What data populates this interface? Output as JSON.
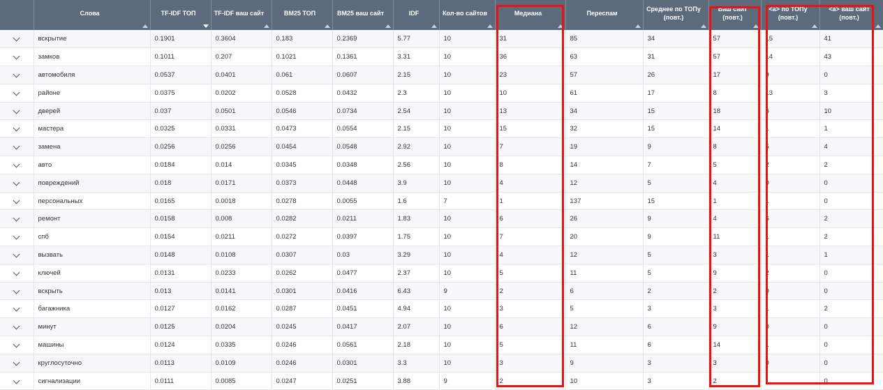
{
  "columns": [
    {
      "label": "",
      "sortable": false
    },
    {
      "label": "Слова",
      "sortable": true
    },
    {
      "label": "TF-IDF ТОП",
      "sortable": true,
      "sorted_desc": true
    },
    {
      "label": "TF-IDF ваш сайт",
      "sortable": true
    },
    {
      "label": "BM25 ТОП",
      "sortable": true
    },
    {
      "label": "BM25 ваш сайт",
      "sortable": true
    },
    {
      "label": "IDF",
      "sortable": true
    },
    {
      "label": "Кол-во сайтов",
      "sortable": true
    },
    {
      "label": "Медиана",
      "sortable": true
    },
    {
      "label": "Переспам",
      "sortable": true
    },
    {
      "label": "Среднее по ТОПу (повт.)",
      "sortable": true
    },
    {
      "label": "Ваш сайт (повт.)",
      "sortable": true
    },
    {
      "label": "<a> по ТОПу (повт.)",
      "sortable": true
    },
    {
      "label": "<a> ваш сайт (повт.)",
      "sortable": true
    }
  ],
  "rows": [
    [
      "вскрытие",
      "0.1901",
      "0.3604",
      "0.183",
      "0.2369",
      "5.77",
      "10",
      "31",
      "85",
      "34",
      "57",
      "15",
      "41"
    ],
    [
      "замков",
      "0.1011",
      "0.207",
      "0.1021",
      "0.1361",
      "3.31",
      "10",
      "36",
      "63",
      "31",
      "57",
      "14",
      "43"
    ],
    [
      "автомобиля",
      "0.0537",
      "0.0401",
      "0.061",
      "0.0607",
      "2.15",
      "10",
      "23",
      "57",
      "26",
      "17",
      "9",
      "0"
    ],
    [
      "районе",
      "0.0375",
      "0.0202",
      "0.0528",
      "0.0432",
      "2.3",
      "10",
      "10",
      "61",
      "17",
      "8",
      "13",
      "3"
    ],
    [
      "дверей",
      "0.037",
      "0.0501",
      "0.0546",
      "0.0734",
      "2.54",
      "10",
      "13",
      "34",
      "15",
      "18",
      "6",
      "10"
    ],
    [
      "мастера",
      "0.0325",
      "0.0331",
      "0.0473",
      "0.0554",
      "2.15",
      "10",
      "15",
      "32",
      "15",
      "14",
      "1",
      "1"
    ],
    [
      "замена",
      "0.0256",
      "0.0256",
      "0.0454",
      "0.0548",
      "2.92",
      "10",
      "7",
      "19",
      "9",
      "8",
      "5",
      "4"
    ],
    [
      "авто",
      "0.0184",
      "0.014",
      "0.0345",
      "0.0348",
      "2.56",
      "10",
      "8",
      "14",
      "7",
      "5",
      "2",
      "2"
    ],
    [
      "повреждений",
      "0.018",
      "0.0171",
      "0.0373",
      "0.0448",
      "3.9",
      "10",
      "4",
      "12",
      "5",
      "4",
      "0",
      "0"
    ],
    [
      "персональных",
      "0.0165",
      "0.0018",
      "0.0278",
      "0.0055",
      "1.6",
      "7",
      "1",
      "137",
      "15",
      "1",
      "1",
      "0"
    ],
    [
      "ремонт",
      "0.0158",
      "0.008",
      "0.0282",
      "0.0211",
      "1.83",
      "10",
      "6",
      "26",
      "9",
      "4",
      "6",
      "2"
    ],
    [
      "спб",
      "0.0154",
      "0.0211",
      "0.0272",
      "0.0397",
      "1.75",
      "10",
      "7",
      "20",
      "9",
      "11",
      "1",
      "2"
    ],
    [
      "вызвать",
      "0.0148",
      "0.0108",
      "0.0307",
      "0.03",
      "3.29",
      "10",
      "4",
      "12",
      "5",
      "3",
      "1",
      "1"
    ],
    [
      "ключей",
      "0.0131",
      "0.0233",
      "0.0262",
      "0.0477",
      "2.37",
      "10",
      "5",
      "11",
      "5",
      "9",
      "2",
      "0"
    ],
    [
      "вскрыть",
      "0.013",
      "0.0141",
      "0.0301",
      "0.0416",
      "6.43",
      "9",
      "2",
      "6",
      "2",
      "2",
      "0",
      "0"
    ],
    [
      "багажника",
      "0.0127",
      "0.0162",
      "0.0287",
      "0.0451",
      "4.94",
      "10",
      "3",
      "5",
      "3",
      "3",
      "1",
      "2"
    ],
    [
      "минут",
      "0.0125",
      "0.0204",
      "0.0245",
      "0.0417",
      "2.07",
      "10",
      "6",
      "12",
      "6",
      "9",
      "0",
      "0"
    ],
    [
      "машины",
      "0.0124",
      "0.0335",
      "0.0246",
      "0.0561",
      "2.18",
      "10",
      "5",
      "11",
      "6",
      "14",
      "1",
      "0"
    ],
    [
      "круглосуточно",
      "0.0113",
      "0.0109",
      "0.0246",
      "0.0301",
      "3.3",
      "10",
      "3",
      "9",
      "3",
      "3",
      "0",
      "0"
    ],
    [
      "сигнализации",
      "0.0111",
      "0.0085",
      "0.0247",
      "0.0251",
      "3.88",
      "9",
      "2",
      "10",
      "3",
      "2",
      "1",
      "0"
    ]
  ],
  "highlight_color": "#ee1111"
}
